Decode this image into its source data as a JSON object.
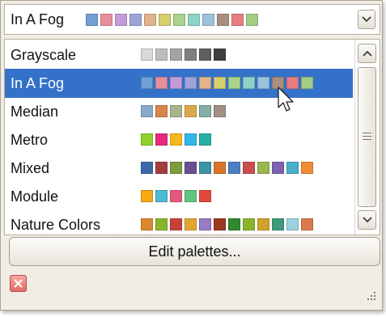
{
  "combo": {
    "value": "In A Fog",
    "colors": [
      "#6f9fd5",
      "#e78e9a",
      "#c59bd8",
      "#9ea4d9",
      "#e3b38c",
      "#d7cf6c",
      "#a8d48d",
      "#8ed4c6",
      "#9cc3db",
      "#a88f80",
      "#e77d7e",
      "#a3cc85"
    ]
  },
  "palettes": [
    {
      "name": "Grayscale",
      "colors": [
        "#d9d9d9",
        "#bdbdbd",
        "#a3a3a3",
        "#808080",
        "#5f5f5f",
        "#3f3f3f"
      ]
    },
    {
      "name": "In A Fog",
      "colors": [
        "#6f9fd5",
        "#e78e9a",
        "#c59bd8",
        "#9ea4d9",
        "#e3b38c",
        "#d7cf6c",
        "#a8d48d",
        "#8ed4c6",
        "#9cc3db",
        "#a88f80",
        "#e77d7e",
        "#a3cc85"
      ]
    },
    {
      "name": "Median",
      "colors": [
        "#88aacf",
        "#d8844d",
        "#aab38c",
        "#d8a94c",
        "#85aea7",
        "#a28f86"
      ]
    },
    {
      "name": "Metro",
      "colors": [
        "#8fd12a",
        "#e82a7f",
        "#f9b71c",
        "#33b5e8",
        "#26b0a3"
      ]
    },
    {
      "name": "Mixed",
      "colors": [
        "#3d6aa6",
        "#a43d3d",
        "#7d9a3d",
        "#6a4f93",
        "#3c93a6",
        "#d9762b",
        "#4a7fc4",
        "#cc4d4d",
        "#98b84d",
        "#7f62b2",
        "#48b0c9",
        "#ef8d37"
      ]
    },
    {
      "name": "Module",
      "colors": [
        "#f7a813",
        "#4dbbd1",
        "#e5587b",
        "#61c47c",
        "#e04a3d"
      ]
    },
    {
      "name": "Nature Colors",
      "colors": [
        "#d9892c",
        "#8ab52b",
        "#c7423a",
        "#e3a52e",
        "#9a7bc5",
        "#9a3a1f",
        "#2f8a2f",
        "#8ab52b",
        "#d1a22c",
        "#3f9a7c",
        "#9bd1e0",
        "#d97a4a"
      ]
    }
  ],
  "selected_index": 1,
  "edit_button_label": "Edit palettes...",
  "icons": {
    "combo_dropdown": "chevron-down-icon",
    "scroll_up": "chevron-up-icon",
    "scroll_down": "chevron-down-icon",
    "scroll_thumb": "grip-icon",
    "close": "close-icon",
    "size_grip": "size-grip-icon",
    "cursor": "mouse-cursor-icon"
  },
  "colors": {
    "selection": "#3471c9",
    "panel_background": "#f1ede4",
    "close_button": "#e56a63"
  }
}
